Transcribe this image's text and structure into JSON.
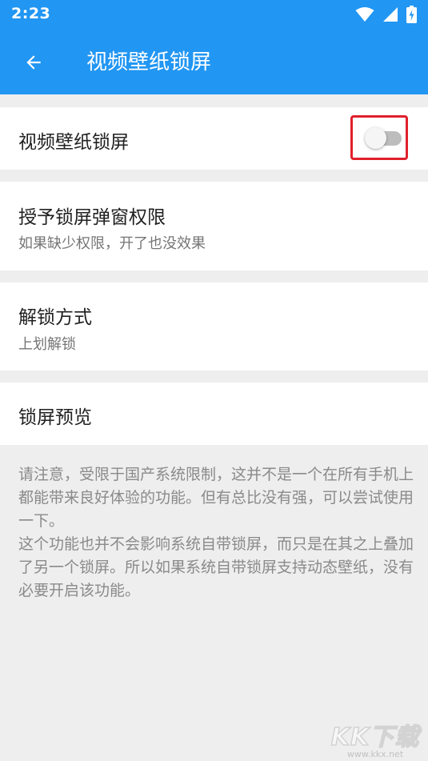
{
  "status_bar": {
    "time": "2:23",
    "icons": [
      "wifi-icon",
      "signal-icon",
      "battery-charging-icon"
    ]
  },
  "app_bar": {
    "back_icon": "arrow-back-icon",
    "title": "视频壁纸锁屏"
  },
  "settings": {
    "video_wallpaper_lock": {
      "title": "视频壁纸锁屏",
      "enabled": false
    },
    "lock_popup_permission": {
      "title": "授予锁屏弹窗权限",
      "subtitle": "如果缺少权限，开了也没效果"
    },
    "unlock_method": {
      "title": "解锁方式",
      "subtitle": "上划解锁"
    },
    "lock_preview": {
      "title": "锁屏预览"
    }
  },
  "note": {
    "paragraph_1": "请注意，受限于国产系统限制，这并不是一个在所有手机上都能带来良好体验的功能。但有总比没有强，可以尝试使用一下。",
    "paragraph_2": "这个功能也并不会影响系统自带锁屏，而只是在其之上叠加了另一个锁屏。所以如果系统自带锁屏支持动态壁纸，没有必要开启该功能。"
  },
  "watermark": {
    "logo": "KK下载",
    "url": "www.kkx.net"
  },
  "colors": {
    "app_bar": "#2196f3",
    "background": "#eeeeee",
    "highlight_frame": "#e0202a",
    "switch_off_track": "#bdbdbd"
  }
}
